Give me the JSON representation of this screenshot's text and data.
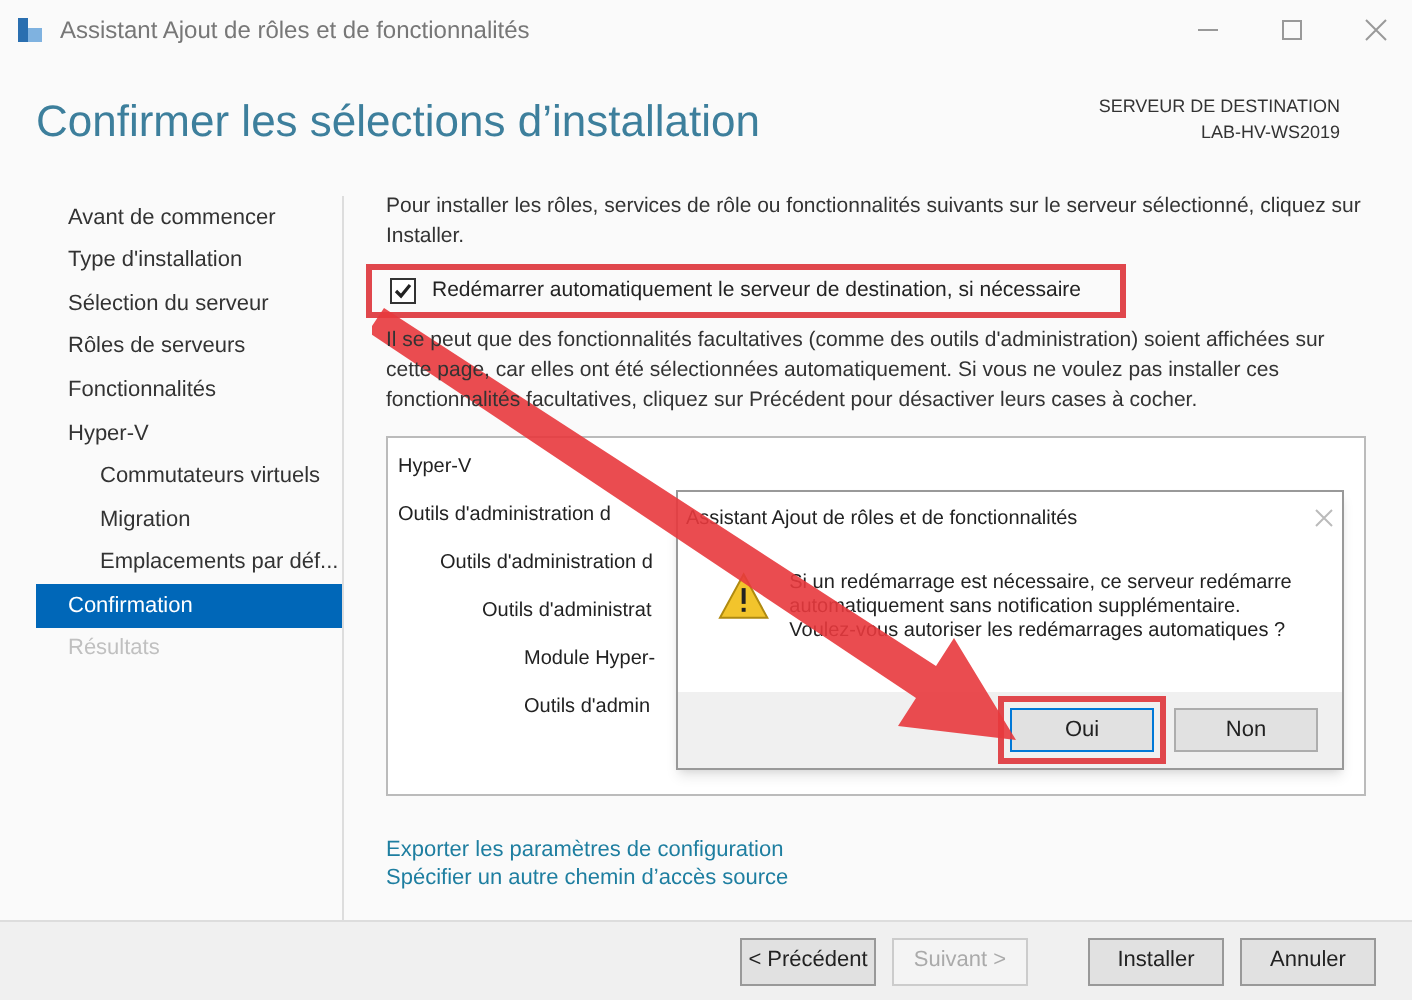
{
  "window": {
    "title": "Assistant Ajout de rôles et de fonctionnalités"
  },
  "header": {
    "title": "Confirmer les sélections d’installation",
    "destination_label": "SERVEUR DE DESTINATION",
    "destination_server": "LAB-HV-WS2019"
  },
  "sidebar": {
    "items": [
      {
        "label": "Avant de commencer",
        "selected": false,
        "disabled": false
      },
      {
        "label": "Type d'installation",
        "selected": false,
        "disabled": false
      },
      {
        "label": "Sélection du serveur",
        "selected": false,
        "disabled": false
      },
      {
        "label": "Rôles de serveurs",
        "selected": false,
        "disabled": false
      },
      {
        "label": "Fonctionnalités",
        "selected": false,
        "disabled": false
      },
      {
        "label": "Hyper-V",
        "selected": false,
        "disabled": false,
        "children": [
          {
            "label": "Commutateurs virtuels",
            "selected": false,
            "disabled": false
          },
          {
            "label": "Migration",
            "selected": false,
            "disabled": false
          },
          {
            "label": "Emplacements par déf...",
            "selected": false,
            "disabled": false
          }
        ]
      },
      {
        "label": "Confirmation",
        "selected": true,
        "disabled": false
      },
      {
        "label": "Résultats",
        "selected": false,
        "disabled": true
      }
    ]
  },
  "intro": "Pour installer les rôles, services de rôle ou fonctionnalités suivants sur le serveur sélectionné, cliquez sur Installer.",
  "restart_checkbox": {
    "label": "Redémarrer automatiquement le serveur de destination, si nécessaire",
    "checked": true
  },
  "note": "Il se peut que des fonctionnalités facultatives (comme des outils d'administration) soient affichées sur cette page, car elles ont été sélectionnées automatiquement. Si vous ne voulez pas installer ces fonctionnalités facultatives, cliquez sur Précédent pour désactiver leurs cases à cocher.",
  "selection_tree": [
    {
      "label": "Hyper-V"
    },
    {
      "label": "Outils d'administration d",
      "children": [
        {
          "label": "Outils d'administration d",
          "children": [
            {
              "label": "Outils d'administrat",
              "children": [
                {
                  "label": "Module Hyper-"
                },
                {
                  "label": "Outils d'admin"
                }
              ]
            }
          ]
        }
      ]
    }
  ],
  "links": [
    "Exporter les paramètres de configuration",
    "Spécifier un autre chemin d’accès source"
  ],
  "buttons": [
    {
      "label": "< Précédent",
      "disabled": false
    },
    {
      "label": "Suivant >",
      "disabled": true
    },
    {
      "label": "Installer",
      "disabled": false
    },
    {
      "label": "Annuler",
      "disabled": false
    }
  ],
  "dialog": {
    "title": "Assistant Ajout de rôles et de fonctionnalités",
    "message": "Si un redémarrage est nécessaire, ce serveur redémarre automatiquement sans notification supplémentaire. Voulez-vous autoriser les redémarrages automatiques ?",
    "buttons": [
      {
        "label": "Oui",
        "selected": true
      },
      {
        "label": "Non",
        "selected": false
      }
    ]
  }
}
